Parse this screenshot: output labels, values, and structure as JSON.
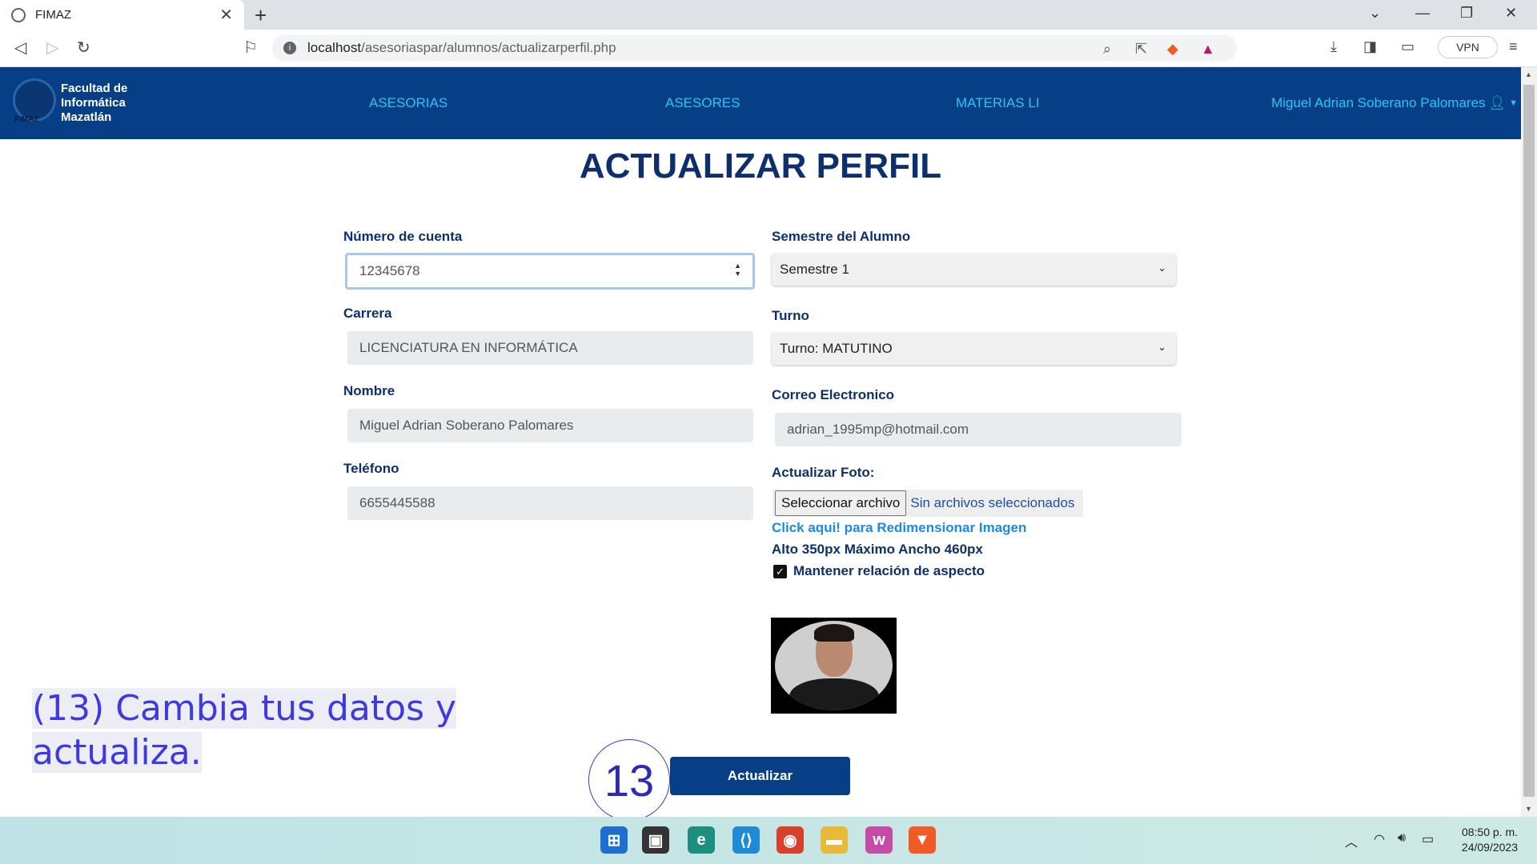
{
  "browser": {
    "tab_title": "FIMAZ",
    "url_host": "localhost",
    "url_path": "/asesoriaspar/alumnos/actualizarperfil.php",
    "vpn_label": "VPN"
  },
  "navbar": {
    "logo_lines": [
      "Facultad de",
      "Informática",
      "Mazatlán"
    ],
    "logo_small": "FIMAZ",
    "links": [
      "ASESORIAS",
      "ASESORES",
      "MATERIAS LI"
    ],
    "user_name": "Miguel Adrian Soberano Palomares"
  },
  "page": {
    "title": "ACTUALIZAR PERFIL"
  },
  "form": {
    "cuenta_label": "Número de cuenta",
    "cuenta_value": "12345678",
    "carrera_label": "Carrera",
    "carrera_value": "LICENCIATURA EN INFORMÁTICA",
    "nombre_label": "Nombre",
    "nombre_value": "Miguel Adrian Soberano Palomares",
    "telefono_label": "Teléfono",
    "telefono_value": "6655445588",
    "semestre_label": "Semestre del Alumno",
    "semestre_value": "Semestre 1",
    "turno_label": "Turno",
    "turno_value": "Turno: MATUTINO",
    "correo_label": "Correo Electronico",
    "correo_value": "adrian_1995mp@hotmail.com",
    "foto_label": "Actualizar Foto:",
    "file_button": "Seleccionar archivo",
    "file_status": "Sin archivos seleccionados",
    "resize_link": "Click aqui! para Redimensionar Imagen",
    "size_hint": "Alto 350px Máximo Ancho 460px",
    "aspect_label": "Mantener relación de aspecto",
    "submit_label": "Actualizar"
  },
  "annotation": {
    "text": "(13) Cambia tus datos y actualiza.",
    "step": "13"
  },
  "taskbar": {
    "time": "08:50 p. m.",
    "date": "24/09/2023"
  },
  "colors": {
    "navbar": "#063f86",
    "link": "#2ec4f3",
    "label": "#0d2f6b",
    "annotation": "#3f3ae0"
  }
}
